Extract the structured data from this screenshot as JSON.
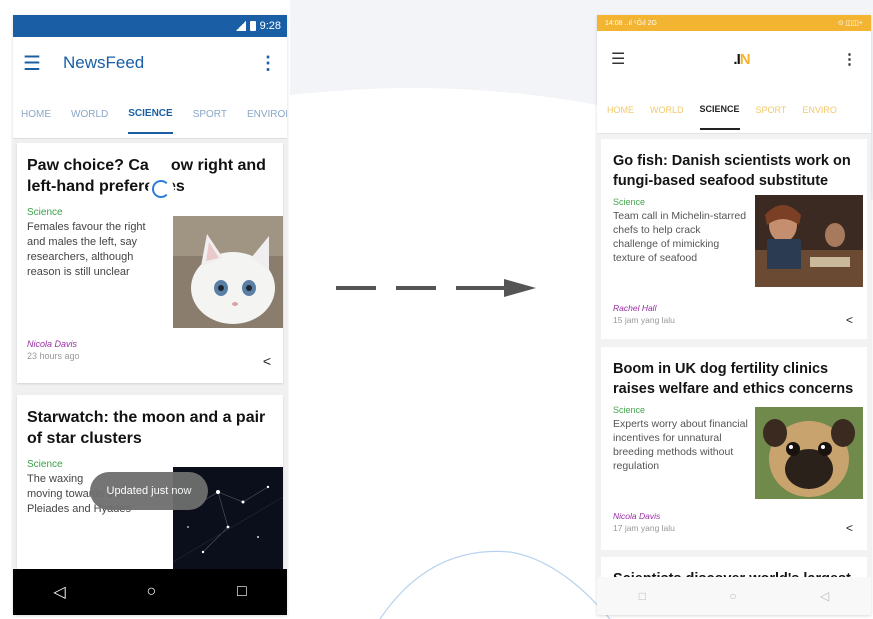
{
  "left_phone": {
    "status_time": "9:28",
    "app_title": "NewsFeed",
    "menu_icon": "hamburger-icon",
    "more_icon": "more-vert-icon",
    "tabs": [
      {
        "label": "HOME"
      },
      {
        "label": "WORLD"
      },
      {
        "label": "SCIENCE"
      },
      {
        "label": "SPORT"
      },
      {
        "label": "ENVIRON"
      }
    ],
    "active_tab": "SCIENCE",
    "cards": [
      {
        "headline_a": "Paw choice? Ca",
        "headline_b": "ow right and",
        "headline_c": "left-hand preferen",
        "headline_d": "es",
        "section": "Science",
        "snippet": "Females favour the right and males the left, say researchers, although reason is still unclear",
        "author": "Nicola Davis",
        "time": "23 hours ago"
      },
      {
        "headline": "Starwatch: the moon and a pair of star clusters",
        "section": "Science",
        "snippet_a": "The waxing",
        "snippet_b": "moving towards the Pleiades and Hyades"
      }
    ],
    "toast": "Updated just now",
    "nav_icons": [
      "back-icon",
      "home-icon",
      "recents-icon"
    ]
  },
  "right_phone": {
    "status_left": "14:08 ..ıl ⁵Ĝıl 2G",
    "status_right": "⊙ ◫◫+",
    "logo_a": ".I",
    "logo_b": "N",
    "tabs": [
      {
        "label": "HOME"
      },
      {
        "label": "WORLD"
      },
      {
        "label": "SCIENCE"
      },
      {
        "label": "SPORT"
      },
      {
        "label": "ENVIRO"
      }
    ],
    "active_tab": "SCIENCE",
    "cards": [
      {
        "headline": "Go fish: Danish scientists work on fungi-based seafood substitute",
        "section": "Science",
        "snippet": "Team call in Michelin-starred chefs to help crack challenge of mimicking texture of seafood",
        "author": "Rachel Hall",
        "time": "15 jam yang lalu"
      },
      {
        "headline": "Boom in UK dog fertility clinics raises welfare and ethics concerns",
        "section": "Science",
        "snippet": "Experts worry about financial incentives for unnatural breeding methods without regulation",
        "author": "Nicola Davis",
        "time": "17 jam yang lalu"
      },
      {
        "headline": "Scientists discover world's largest"
      }
    ],
    "nav_icons": [
      "recents-icon",
      "home-icon",
      "back-icon"
    ]
  },
  "colors": {
    "left_brand": "#1a5fa6",
    "right_brand": "#f2b431",
    "section_green": "#3aa04a",
    "author_purple": "#9a2ea5"
  }
}
